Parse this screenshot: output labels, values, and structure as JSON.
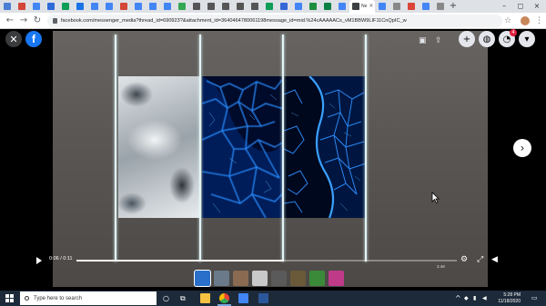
{
  "browser": {
    "url": "facebook.com/messenger_media?thread_id=690923?&attachment_id=3640464780061198message_id=mid.%24cAAAAACs_vM1BBW9LIF11CnQpIC_w",
    "active_tab_title": "Ne",
    "tab_close": "×",
    "new_tab": "+",
    "tab_colors": [
      "#4a7fd4",
      "#d44638",
      "#4285f4",
      "#2d6bd9",
      "#0f9d58",
      "#1a73e8",
      "#4285f4",
      "#4285f4",
      "#d44638",
      "#4285f4",
      "#4285f4",
      "#4285f4",
      "#34a853",
      "#555555",
      "#555555",
      "#555555",
      "#555555",
      "#555555",
      "#0f9d58",
      "#3367d6",
      "#4285f4",
      "#1e8e3e",
      "#0b8043",
      "#4285f4",
      "#3c4043",
      "#4285f4",
      "#888888",
      "#db4437",
      "#4285f4",
      "#888888"
    ],
    "window_controls": [
      "–",
      "◻",
      "×"
    ],
    "nav": {
      "back": "←",
      "forward": "→",
      "reload": "↻"
    },
    "star": "☆",
    "menu": "⋮"
  },
  "viewer": {
    "close": "✕",
    "logo": "f",
    "notification_count": "4",
    "buttons": {
      "add": "+",
      "messenger": "◍",
      "notifications": "◔",
      "account": "▾"
    },
    "next": "›",
    "video": {
      "time": "0:06 / 0:11",
      "progress_fraction": 0.545,
      "resolution_label": "3.48"
    },
    "thumbnail_colors": [
      "#2a6fc9",
      "#6a7a8a",
      "#8a6a50",
      "#c9c9c9",
      "#5a5a5a",
      "#6a5a3a",
      "#3a8a3a",
      "#c03a8a"
    ]
  },
  "taskbar": {
    "search_placeholder": "Type here to search",
    "clock_time": "5:28 PM",
    "clock_date": "11/18/2020",
    "app_colors": [
      "#f5c242",
      "#4285f4",
      "#2b579a",
      "#1e6fc4"
    ]
  }
}
